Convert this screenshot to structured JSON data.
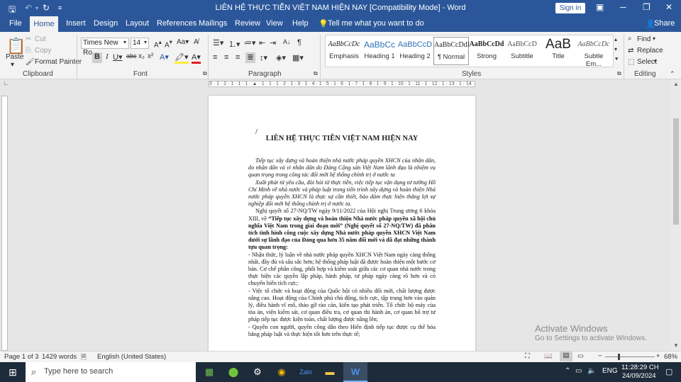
{
  "titlebar": {
    "doc_title": "LIÊN HỆ THỰC TIỄN VIỆT NAM HIỆN NAY [Compatibility Mode] - Word",
    "sign_in": "Sign in"
  },
  "tabs": [
    "File",
    "Home",
    "Insert",
    "Design",
    "Layout",
    "References",
    "Mailings",
    "Review",
    "View",
    "Help"
  ],
  "tell_me": "Tell me what you want to do",
  "share": "Share",
  "clipboard": {
    "paste": "Paste",
    "cut": "Cut",
    "copy": "Copy",
    "format_painter": "Format Painter",
    "label": "Clipboard"
  },
  "font": {
    "name": "Times New Ro",
    "size": "14",
    "label": "Font"
  },
  "paragraph": {
    "label": "Paragraph"
  },
  "styles": {
    "label": "Styles",
    "items": [
      {
        "preview": "AaBbCcDc",
        "name": "Emphasis"
      },
      {
        "preview": "AaBbCc",
        "name": "Heading 1"
      },
      {
        "preview": "AaBbCcD",
        "name": "Heading 2"
      },
      {
        "preview": "AaBbCcDdI",
        "name": "¶ Normal"
      },
      {
        "preview": "AaBbCcDd",
        "name": "Strong"
      },
      {
        "preview": "AaBbCcD",
        "name": "Subtitle"
      },
      {
        "preview": "AaB",
        "name": "Title"
      },
      {
        "preview": "AaBbCcDc",
        "name": "Subtle Em..."
      }
    ]
  },
  "editing": {
    "find": "Find",
    "replace": "Replace",
    "select": "Select",
    "label": "Editing"
  },
  "ruler_text": "3 · 1 · 2 · 1 · 1 · 1 · ▲ · 1 · 1 · 1 · 2 · 1 · 3 · 1 · 4 · 1 · 5 · 1 · 6 · 1 · 7 · 1 · 8 · 1 · 9 · 1 · 10 · 1 · 11 · 1 · 12 · 1 · 13 · 1 · 14 · 1 · 15 · 1 · 16 · 1 · 17 · 1",
  "document": {
    "heading": "LIÊN HỆ THỰC TIỄN VIỆT NAM HIỆN NAY",
    "intro_italic_1": "Tiếp tục xây dựng và hoàn thiện nhà nước pháp quyền XHCN của nhân dân, do nhân dân và vì nhân dân do Đảng Cộng sản Việt Nam lãnh đạo là nhiệm vụ quan trọng trong công tác đổi mới hệ thống chính trị ở nước ta",
    "intro_italic_2": "Xuất phát từ yêu cầu, đòi hỏi từ thực tiễn, việc tiếp tục vận dụng tư tưởng Hồ Chí Minh về nhà nước và pháp luật trong tiến trình xây dựng và hoàn thiện Nhà nước pháp quyền XHCN là thực sự cần thiết, bảo đảm thực hiện thắng lợi sự nghiệp đổi mới hệ thống chính trị ở nước ta.",
    "para_normal_start": "Nghị quyết số 27-NQ/TW ngày 9/11/2022 của Hội nghị Trung ương 6 khóa XIII, về",
    "para_bold": "“Tiếp tục xây dựng và hoàn thiện Nhà nước pháp quyền xã hội chủ nghĩa Việt Nam trong giai đoạn mới” (Nghị quyết số 27-NQ/TW) đã phân tích tình hình công cuộc xây dựng Nhà nước pháp quyền XHCN Việt Nam dưới sự lãnh đạo của Đảng qua hơn 35 năm đổi mới và đã đạt những thành tựu quan trọng:",
    "bullet_1": "- Nhận thức, lý luận về nhà nước pháp quyền XHCN Việt Nam ngày càng thống nhất, đầy đủ và sâu sắc hơn; hệ thống pháp luật đã được hoàn thiện một bước cơ bản. Cơ chế phân công, phối hợp và kiểm soát giữa các cơ quan nhà nước trong thực hiện các quyền lập pháp, hành pháp, tư pháp ngày càng rõ hơn và có chuyển biến tích cực;",
    "bullet_2": "- Việc tổ chức và hoạt động của Quốc hội có nhiều đổi mới, chất lượng được nâng cao. Hoạt động của Chính phủ chủ động, tích cực, tập trung hơn vào quản lý, điều hành vĩ mô, tháo gỡ rào cản, kiến tạo phát triển. Tổ chức bộ máy của tòa án, viện kiểm sát, cơ quan điều tra, cơ quan thi hành án, cơ quan bổ trợ tư pháp tiếp tục được kiện toàn, chất lượng được nâng lên;",
    "bullet_3": "- Quyền con người, quyền công dân theo Hiến định tiếp tục được cụ thể hóa bằng pháp luật và thực hiện tốt hơn trên thực tế;"
  },
  "watermark": {
    "line1": "Activate Windows",
    "line2": "Go to Settings to activate Windows."
  },
  "status": {
    "page": "Page 1 of 3",
    "words": "1429 words",
    "language": "English (United States)",
    "zoom": "68%"
  },
  "taskbar": {
    "search_placeholder": "Type here to search",
    "time": "11:28:29 CH",
    "date": "24/09/2024",
    "lang": "ENG"
  },
  "colors": {
    "word_blue": "#2b579a",
    "taskbar": "#1d2b3a"
  }
}
